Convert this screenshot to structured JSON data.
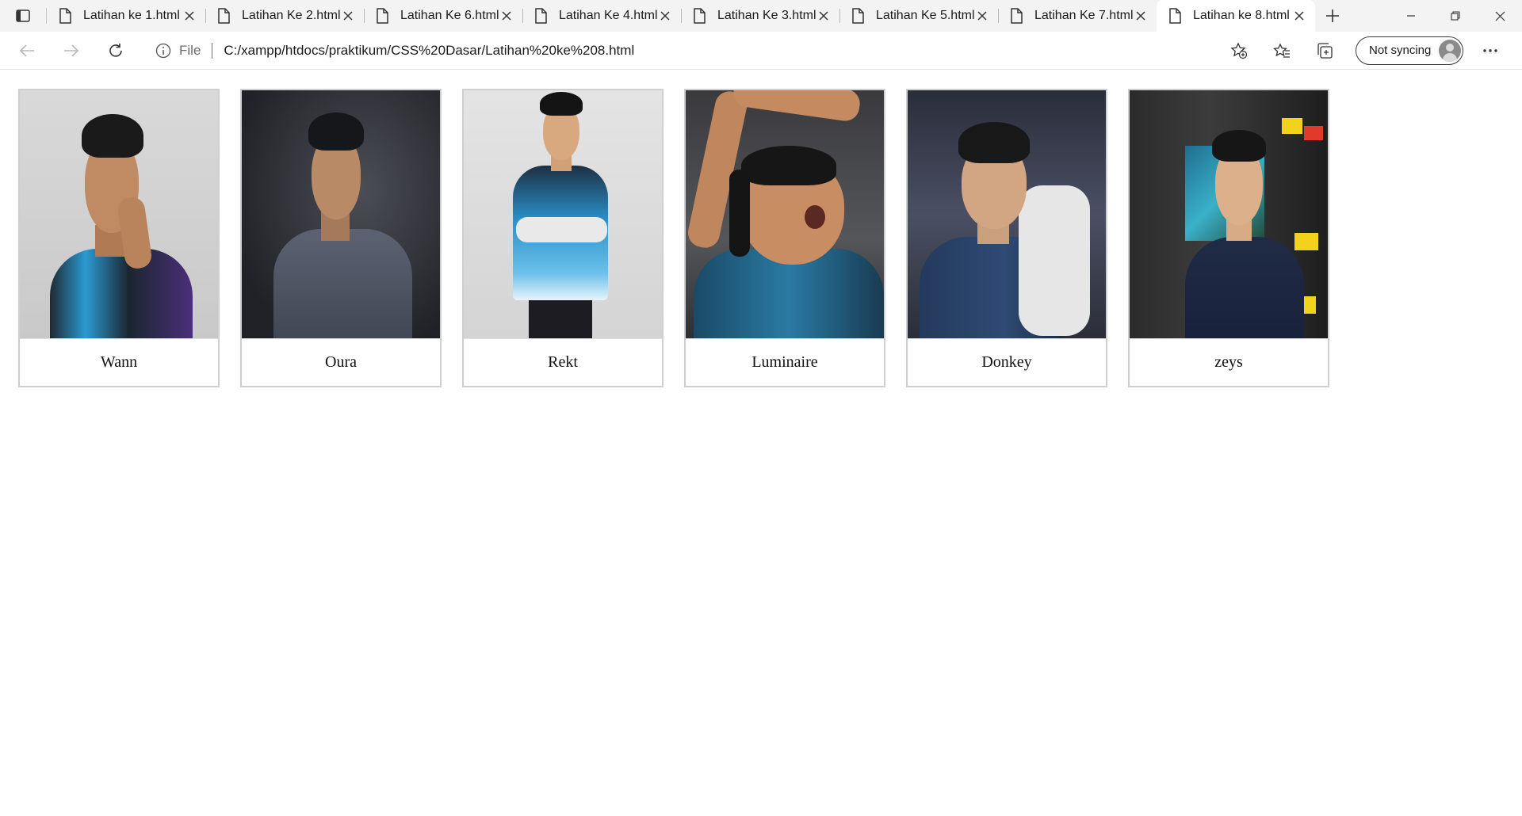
{
  "browser": {
    "tabs": [
      {
        "title": "Latihan ke 1.html",
        "active": false
      },
      {
        "title": "Latihan Ke 2.html",
        "active": false
      },
      {
        "title": "Latihan Ke 6.html",
        "active": false
      },
      {
        "title": "Latihan Ke 4.html",
        "active": false
      },
      {
        "title": "Latihan Ke 3.html",
        "active": false
      },
      {
        "title": "Latihan Ke 5.html",
        "active": false
      },
      {
        "title": "Latihan Ke 7.html",
        "active": false
      },
      {
        "title": "Latihan ke 8.html",
        "active": true
      }
    ],
    "address": {
      "scheme_label": "File",
      "url": "C:/xampp/htdocs/praktikum/CSS%20Dasar/Latihan%20ke%208.html"
    },
    "profile_label": "Not syncing"
  },
  "gallery": {
    "cards": [
      {
        "name": "Wann"
      },
      {
        "name": "Oura"
      },
      {
        "name": "Rekt"
      },
      {
        "name": "Luminaire"
      },
      {
        "name": "Donkey"
      },
      {
        "name": "zeys"
      }
    ]
  },
  "colors": {
    "tabstrip_bg": "#f3f3f3",
    "card_border": "#cfcfcf",
    "jersey_blue": "#2a9fd6",
    "jersey_dark": "#1e3b52"
  }
}
